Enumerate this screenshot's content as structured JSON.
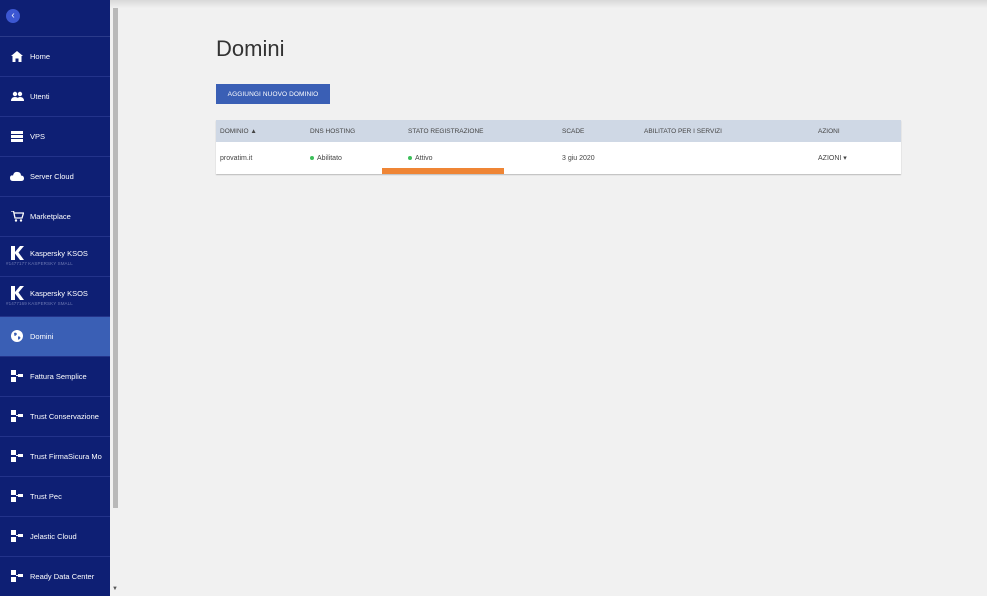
{
  "sidebar": {
    "items": [
      {
        "label": "Home",
        "icon": "home-icon"
      },
      {
        "label": "Utenti",
        "icon": "users-icon"
      },
      {
        "label": "VPS",
        "icon": "server-icon"
      },
      {
        "label": "Server Cloud",
        "icon": "cloud-icon"
      },
      {
        "label": "Marketplace",
        "icon": "cart-icon"
      },
      {
        "label": "Kaspersky KSOS",
        "sub": "#1477177 KASPERSKY SMALL",
        "icon": "kaspersky-icon"
      },
      {
        "label": "Kaspersky KSOS",
        "sub": "#1477169 KASPERSKY SMALL",
        "icon": "kaspersky-icon"
      },
      {
        "label": "Domini",
        "icon": "globe-icon"
      },
      {
        "label": "Fattura Semplice",
        "icon": "hierarchy-icon"
      },
      {
        "label": "Trust Conservazione",
        "icon": "hierarchy-icon"
      },
      {
        "label": "Trust FirmaSicura Mo",
        "icon": "hierarchy-icon"
      },
      {
        "label": "Trust Pec",
        "icon": "hierarchy-icon"
      },
      {
        "label": "Jelastic Cloud",
        "icon": "hierarchy-icon"
      },
      {
        "label": "Ready Data Center",
        "icon": "hierarchy-icon"
      }
    ]
  },
  "main": {
    "title": "Domini",
    "add_button": "AGGIUNGI NUOVO DOMINIO",
    "table": {
      "headers": [
        "DOMINIO ▲",
        "DNS HOSTING",
        "STATO REGISTRAZIONE",
        "SCADE",
        "ABILITATO PER I SERVIZI",
        "AZIONI"
      ],
      "rows": [
        {
          "domain": "provatim.it",
          "dns": "Abilitato",
          "status": "Attivo",
          "expires": "3 giu 2020",
          "services": "",
          "actions": "AZIONI ▾"
        }
      ]
    }
  },
  "colors": {
    "sidebar_bg": "#0e1f74",
    "accent": "#3a5fb5",
    "status_green": "#3cbf5a",
    "highlight": "#ef8535"
  }
}
